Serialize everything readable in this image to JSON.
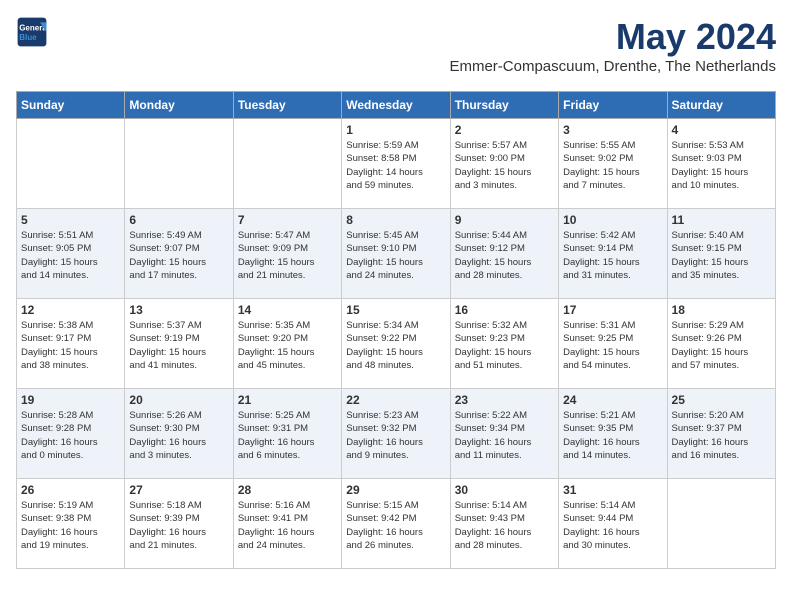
{
  "logo": {
    "line1": "General",
    "line2": "Blue"
  },
  "title": "May 2024",
  "subtitle": "Emmer-Compascuum, Drenthe, The Netherlands",
  "days_of_week": [
    "Sunday",
    "Monday",
    "Tuesday",
    "Wednesday",
    "Thursday",
    "Friday",
    "Saturday"
  ],
  "weeks": [
    [
      {
        "day": "",
        "info": ""
      },
      {
        "day": "",
        "info": ""
      },
      {
        "day": "",
        "info": ""
      },
      {
        "day": "1",
        "info": "Sunrise: 5:59 AM\nSunset: 8:58 PM\nDaylight: 14 hours\nand 59 minutes."
      },
      {
        "day": "2",
        "info": "Sunrise: 5:57 AM\nSunset: 9:00 PM\nDaylight: 15 hours\nand 3 minutes."
      },
      {
        "day": "3",
        "info": "Sunrise: 5:55 AM\nSunset: 9:02 PM\nDaylight: 15 hours\nand 7 minutes."
      },
      {
        "day": "4",
        "info": "Sunrise: 5:53 AM\nSunset: 9:03 PM\nDaylight: 15 hours\nand 10 minutes."
      }
    ],
    [
      {
        "day": "5",
        "info": "Sunrise: 5:51 AM\nSunset: 9:05 PM\nDaylight: 15 hours\nand 14 minutes."
      },
      {
        "day": "6",
        "info": "Sunrise: 5:49 AM\nSunset: 9:07 PM\nDaylight: 15 hours\nand 17 minutes."
      },
      {
        "day": "7",
        "info": "Sunrise: 5:47 AM\nSunset: 9:09 PM\nDaylight: 15 hours\nand 21 minutes."
      },
      {
        "day": "8",
        "info": "Sunrise: 5:45 AM\nSunset: 9:10 PM\nDaylight: 15 hours\nand 24 minutes."
      },
      {
        "day": "9",
        "info": "Sunrise: 5:44 AM\nSunset: 9:12 PM\nDaylight: 15 hours\nand 28 minutes."
      },
      {
        "day": "10",
        "info": "Sunrise: 5:42 AM\nSunset: 9:14 PM\nDaylight: 15 hours\nand 31 minutes."
      },
      {
        "day": "11",
        "info": "Sunrise: 5:40 AM\nSunset: 9:15 PM\nDaylight: 15 hours\nand 35 minutes."
      }
    ],
    [
      {
        "day": "12",
        "info": "Sunrise: 5:38 AM\nSunset: 9:17 PM\nDaylight: 15 hours\nand 38 minutes."
      },
      {
        "day": "13",
        "info": "Sunrise: 5:37 AM\nSunset: 9:19 PM\nDaylight: 15 hours\nand 41 minutes."
      },
      {
        "day": "14",
        "info": "Sunrise: 5:35 AM\nSunset: 9:20 PM\nDaylight: 15 hours\nand 45 minutes."
      },
      {
        "day": "15",
        "info": "Sunrise: 5:34 AM\nSunset: 9:22 PM\nDaylight: 15 hours\nand 48 minutes."
      },
      {
        "day": "16",
        "info": "Sunrise: 5:32 AM\nSunset: 9:23 PM\nDaylight: 15 hours\nand 51 minutes."
      },
      {
        "day": "17",
        "info": "Sunrise: 5:31 AM\nSunset: 9:25 PM\nDaylight: 15 hours\nand 54 minutes."
      },
      {
        "day": "18",
        "info": "Sunrise: 5:29 AM\nSunset: 9:26 PM\nDaylight: 15 hours\nand 57 minutes."
      }
    ],
    [
      {
        "day": "19",
        "info": "Sunrise: 5:28 AM\nSunset: 9:28 PM\nDaylight: 16 hours\nand 0 minutes."
      },
      {
        "day": "20",
        "info": "Sunrise: 5:26 AM\nSunset: 9:30 PM\nDaylight: 16 hours\nand 3 minutes."
      },
      {
        "day": "21",
        "info": "Sunrise: 5:25 AM\nSunset: 9:31 PM\nDaylight: 16 hours\nand 6 minutes."
      },
      {
        "day": "22",
        "info": "Sunrise: 5:23 AM\nSunset: 9:32 PM\nDaylight: 16 hours\nand 9 minutes."
      },
      {
        "day": "23",
        "info": "Sunrise: 5:22 AM\nSunset: 9:34 PM\nDaylight: 16 hours\nand 11 minutes."
      },
      {
        "day": "24",
        "info": "Sunrise: 5:21 AM\nSunset: 9:35 PM\nDaylight: 16 hours\nand 14 minutes."
      },
      {
        "day": "25",
        "info": "Sunrise: 5:20 AM\nSunset: 9:37 PM\nDaylight: 16 hours\nand 16 minutes."
      }
    ],
    [
      {
        "day": "26",
        "info": "Sunrise: 5:19 AM\nSunset: 9:38 PM\nDaylight: 16 hours\nand 19 minutes."
      },
      {
        "day": "27",
        "info": "Sunrise: 5:18 AM\nSunset: 9:39 PM\nDaylight: 16 hours\nand 21 minutes."
      },
      {
        "day": "28",
        "info": "Sunrise: 5:16 AM\nSunset: 9:41 PM\nDaylight: 16 hours\nand 24 minutes."
      },
      {
        "day": "29",
        "info": "Sunrise: 5:15 AM\nSunset: 9:42 PM\nDaylight: 16 hours\nand 26 minutes."
      },
      {
        "day": "30",
        "info": "Sunrise: 5:14 AM\nSunset: 9:43 PM\nDaylight: 16 hours\nand 28 minutes."
      },
      {
        "day": "31",
        "info": "Sunrise: 5:14 AM\nSunset: 9:44 PM\nDaylight: 16 hours\nand 30 minutes."
      },
      {
        "day": "",
        "info": ""
      }
    ]
  ]
}
